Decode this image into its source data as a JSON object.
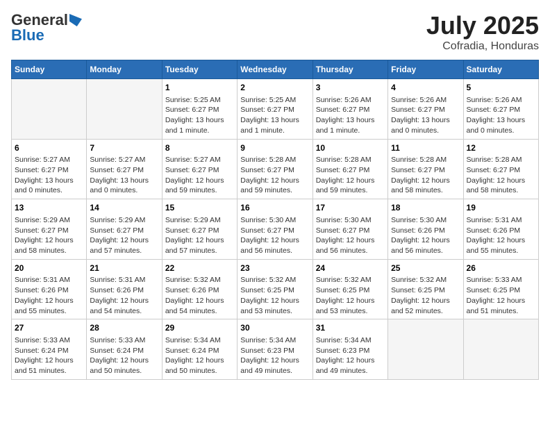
{
  "logo": {
    "general": "General",
    "blue": "Blue"
  },
  "title": "July 2025",
  "subtitle": "Cofradia, Honduras",
  "weekdays": [
    "Sunday",
    "Monday",
    "Tuesday",
    "Wednesday",
    "Thursday",
    "Friday",
    "Saturday"
  ],
  "weeks": [
    [
      {
        "day": "",
        "empty": true
      },
      {
        "day": "",
        "empty": true
      },
      {
        "day": "1",
        "sunrise": "Sunrise: 5:25 AM",
        "sunset": "Sunset: 6:27 PM",
        "daylight": "Daylight: 13 hours and 1 minute."
      },
      {
        "day": "2",
        "sunrise": "Sunrise: 5:25 AM",
        "sunset": "Sunset: 6:27 PM",
        "daylight": "Daylight: 13 hours and 1 minute."
      },
      {
        "day": "3",
        "sunrise": "Sunrise: 5:26 AM",
        "sunset": "Sunset: 6:27 PM",
        "daylight": "Daylight: 13 hours and 1 minute."
      },
      {
        "day": "4",
        "sunrise": "Sunrise: 5:26 AM",
        "sunset": "Sunset: 6:27 PM",
        "daylight": "Daylight: 13 hours and 0 minutes."
      },
      {
        "day": "5",
        "sunrise": "Sunrise: 5:26 AM",
        "sunset": "Sunset: 6:27 PM",
        "daylight": "Daylight: 13 hours and 0 minutes."
      }
    ],
    [
      {
        "day": "6",
        "sunrise": "Sunrise: 5:27 AM",
        "sunset": "Sunset: 6:27 PM",
        "daylight": "Daylight: 13 hours and 0 minutes."
      },
      {
        "day": "7",
        "sunrise": "Sunrise: 5:27 AM",
        "sunset": "Sunset: 6:27 PM",
        "daylight": "Daylight: 13 hours and 0 minutes."
      },
      {
        "day": "8",
        "sunrise": "Sunrise: 5:27 AM",
        "sunset": "Sunset: 6:27 PM",
        "daylight": "Daylight: 12 hours and 59 minutes."
      },
      {
        "day": "9",
        "sunrise": "Sunrise: 5:28 AM",
        "sunset": "Sunset: 6:27 PM",
        "daylight": "Daylight: 12 hours and 59 minutes."
      },
      {
        "day": "10",
        "sunrise": "Sunrise: 5:28 AM",
        "sunset": "Sunset: 6:27 PM",
        "daylight": "Daylight: 12 hours and 59 minutes."
      },
      {
        "day": "11",
        "sunrise": "Sunrise: 5:28 AM",
        "sunset": "Sunset: 6:27 PM",
        "daylight": "Daylight: 12 hours and 58 minutes."
      },
      {
        "day": "12",
        "sunrise": "Sunrise: 5:28 AM",
        "sunset": "Sunset: 6:27 PM",
        "daylight": "Daylight: 12 hours and 58 minutes."
      }
    ],
    [
      {
        "day": "13",
        "sunrise": "Sunrise: 5:29 AM",
        "sunset": "Sunset: 6:27 PM",
        "daylight": "Daylight: 12 hours and 58 minutes."
      },
      {
        "day": "14",
        "sunrise": "Sunrise: 5:29 AM",
        "sunset": "Sunset: 6:27 PM",
        "daylight": "Daylight: 12 hours and 57 minutes."
      },
      {
        "day": "15",
        "sunrise": "Sunrise: 5:29 AM",
        "sunset": "Sunset: 6:27 PM",
        "daylight": "Daylight: 12 hours and 57 minutes."
      },
      {
        "day": "16",
        "sunrise": "Sunrise: 5:30 AM",
        "sunset": "Sunset: 6:27 PM",
        "daylight": "Daylight: 12 hours and 56 minutes."
      },
      {
        "day": "17",
        "sunrise": "Sunrise: 5:30 AM",
        "sunset": "Sunset: 6:27 PM",
        "daylight": "Daylight: 12 hours and 56 minutes."
      },
      {
        "day": "18",
        "sunrise": "Sunrise: 5:30 AM",
        "sunset": "Sunset: 6:26 PM",
        "daylight": "Daylight: 12 hours and 56 minutes."
      },
      {
        "day": "19",
        "sunrise": "Sunrise: 5:31 AM",
        "sunset": "Sunset: 6:26 PM",
        "daylight": "Daylight: 12 hours and 55 minutes."
      }
    ],
    [
      {
        "day": "20",
        "sunrise": "Sunrise: 5:31 AM",
        "sunset": "Sunset: 6:26 PM",
        "daylight": "Daylight: 12 hours and 55 minutes."
      },
      {
        "day": "21",
        "sunrise": "Sunrise: 5:31 AM",
        "sunset": "Sunset: 6:26 PM",
        "daylight": "Daylight: 12 hours and 54 minutes."
      },
      {
        "day": "22",
        "sunrise": "Sunrise: 5:32 AM",
        "sunset": "Sunset: 6:26 PM",
        "daylight": "Daylight: 12 hours and 54 minutes."
      },
      {
        "day": "23",
        "sunrise": "Sunrise: 5:32 AM",
        "sunset": "Sunset: 6:25 PM",
        "daylight": "Daylight: 12 hours and 53 minutes."
      },
      {
        "day": "24",
        "sunrise": "Sunrise: 5:32 AM",
        "sunset": "Sunset: 6:25 PM",
        "daylight": "Daylight: 12 hours and 53 minutes."
      },
      {
        "day": "25",
        "sunrise": "Sunrise: 5:32 AM",
        "sunset": "Sunset: 6:25 PM",
        "daylight": "Daylight: 12 hours and 52 minutes."
      },
      {
        "day": "26",
        "sunrise": "Sunrise: 5:33 AM",
        "sunset": "Sunset: 6:25 PM",
        "daylight": "Daylight: 12 hours and 51 minutes."
      }
    ],
    [
      {
        "day": "27",
        "sunrise": "Sunrise: 5:33 AM",
        "sunset": "Sunset: 6:24 PM",
        "daylight": "Daylight: 12 hours and 51 minutes."
      },
      {
        "day": "28",
        "sunrise": "Sunrise: 5:33 AM",
        "sunset": "Sunset: 6:24 PM",
        "daylight": "Daylight: 12 hours and 50 minutes."
      },
      {
        "day": "29",
        "sunrise": "Sunrise: 5:34 AM",
        "sunset": "Sunset: 6:24 PM",
        "daylight": "Daylight: 12 hours and 50 minutes."
      },
      {
        "day": "30",
        "sunrise": "Sunrise: 5:34 AM",
        "sunset": "Sunset: 6:23 PM",
        "daylight": "Daylight: 12 hours and 49 minutes."
      },
      {
        "day": "31",
        "sunrise": "Sunrise: 5:34 AM",
        "sunset": "Sunset: 6:23 PM",
        "daylight": "Daylight: 12 hours and 49 minutes."
      },
      {
        "day": "",
        "empty": true
      },
      {
        "day": "",
        "empty": true
      }
    ]
  ]
}
